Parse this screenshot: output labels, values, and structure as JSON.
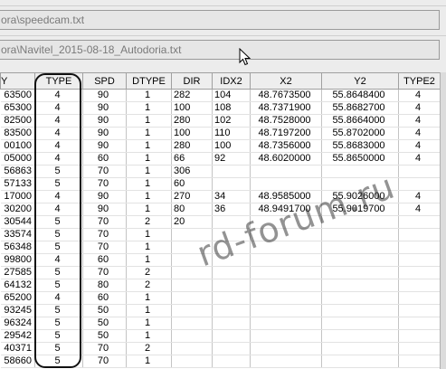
{
  "paths": {
    "first": "ora\\speedcam.txt",
    "second": "ora\\Navitel_2015-08-18_Autodoria.txt"
  },
  "columns": [
    "Y",
    "TYPE",
    "SPD",
    "DTYPE",
    "DIR",
    "IDX2",
    "X2",
    "Y2",
    "TYPE2"
  ],
  "rows": [
    [
      "63500",
      "4",
      "90",
      "1",
      "282",
      "104",
      "48.7673500",
      "55.8648400",
      "4"
    ],
    [
      "65300",
      "4",
      "90",
      "1",
      "100",
      "108",
      "48.7371900",
      "55.8682700",
      "4"
    ],
    [
      "82500",
      "4",
      "90",
      "1",
      "280",
      "102",
      "48.7528000",
      "55.8664000",
      "4"
    ],
    [
      "83500",
      "4",
      "90",
      "1",
      "100",
      "110",
      "48.7197200",
      "55.8702000",
      "4"
    ],
    [
      "00100",
      "4",
      "90",
      "1",
      "280",
      "100",
      "48.7356000",
      "55.8683000",
      "4"
    ],
    [
      "05000",
      "4",
      "60",
      "1",
      "66",
      "92",
      "48.6020000",
      "55.8650000",
      "4"
    ],
    [
      "56863",
      "5",
      "70",
      "1",
      "306",
      "",
      "",
      "",
      ""
    ],
    [
      "57133",
      "5",
      "70",
      "1",
      "60",
      "",
      "",
      "",
      ""
    ],
    [
      "17000",
      "4",
      "90",
      "1",
      "270",
      "34",
      "48.9585000",
      "55.9026000",
      "4"
    ],
    [
      "30200",
      "4",
      "90",
      "1",
      "80",
      "36",
      "48.9491700",
      "55.9019700",
      "4"
    ],
    [
      "30544",
      "5",
      "70",
      "2",
      "20",
      "",
      "",
      "",
      ""
    ],
    [
      "33574",
      "5",
      "70",
      "1",
      "",
      "",
      "",
      "",
      ""
    ],
    [
      "56348",
      "5",
      "70",
      "1",
      "",
      "",
      "",
      "",
      ""
    ],
    [
      "99800",
      "4",
      "60",
      "1",
      "",
      "",
      "",
      "",
      ""
    ],
    [
      "27585",
      "5",
      "70",
      "2",
      "",
      "",
      "",
      "",
      ""
    ],
    [
      "64132",
      "5",
      "80",
      "2",
      "",
      "",
      "",
      "",
      ""
    ],
    [
      "65200",
      "4",
      "60",
      "1",
      "",
      "",
      "",
      "",
      ""
    ],
    [
      "93245",
      "5",
      "50",
      "1",
      "",
      "",
      "",
      "",
      ""
    ],
    [
      "96324",
      "5",
      "50",
      "1",
      "",
      "",
      "",
      "",
      ""
    ],
    [
      "29542",
      "5",
      "50",
      "1",
      "",
      "",
      "",
      "",
      ""
    ],
    [
      "40371",
      "5",
      "70",
      "2",
      "",
      "",
      "",
      "",
      ""
    ],
    [
      "58660",
      "5",
      "70",
      "1",
      "",
      "",
      "",
      "",
      ""
    ]
  ],
  "watermark": "rd-forum.ru",
  "icons": {
    "cursor": "mouse-pointer-icon"
  }
}
